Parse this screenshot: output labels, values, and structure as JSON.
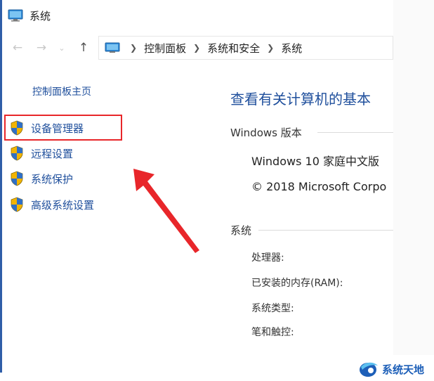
{
  "window": {
    "title": "系统"
  },
  "navigation": {
    "breadcrumbs": [
      "控制面板",
      "系统和安全",
      "系统"
    ]
  },
  "left_pane": {
    "home_link": "控制面板主页",
    "links": [
      {
        "label": "设备管理器",
        "highlighted": true
      },
      {
        "label": "远程设置"
      },
      {
        "label": "系统保护"
      },
      {
        "label": "高级系统设置"
      }
    ]
  },
  "main": {
    "heading": "查看有关计算机的基本",
    "windows_edition_label": "Windows 版本",
    "edition": "Windows 10 家庭中文版",
    "copyright": "© 2018 Microsoft Corpo",
    "system_label": "系统",
    "properties": [
      "处理器:",
      "已安装的内存(RAM):",
      "系统类型:",
      "笔和触控:"
    ]
  },
  "annotation": {
    "highlight_color": "#e8262a",
    "arrow_color": "#e8262a"
  },
  "watermark": {
    "text": "系统天地"
  }
}
